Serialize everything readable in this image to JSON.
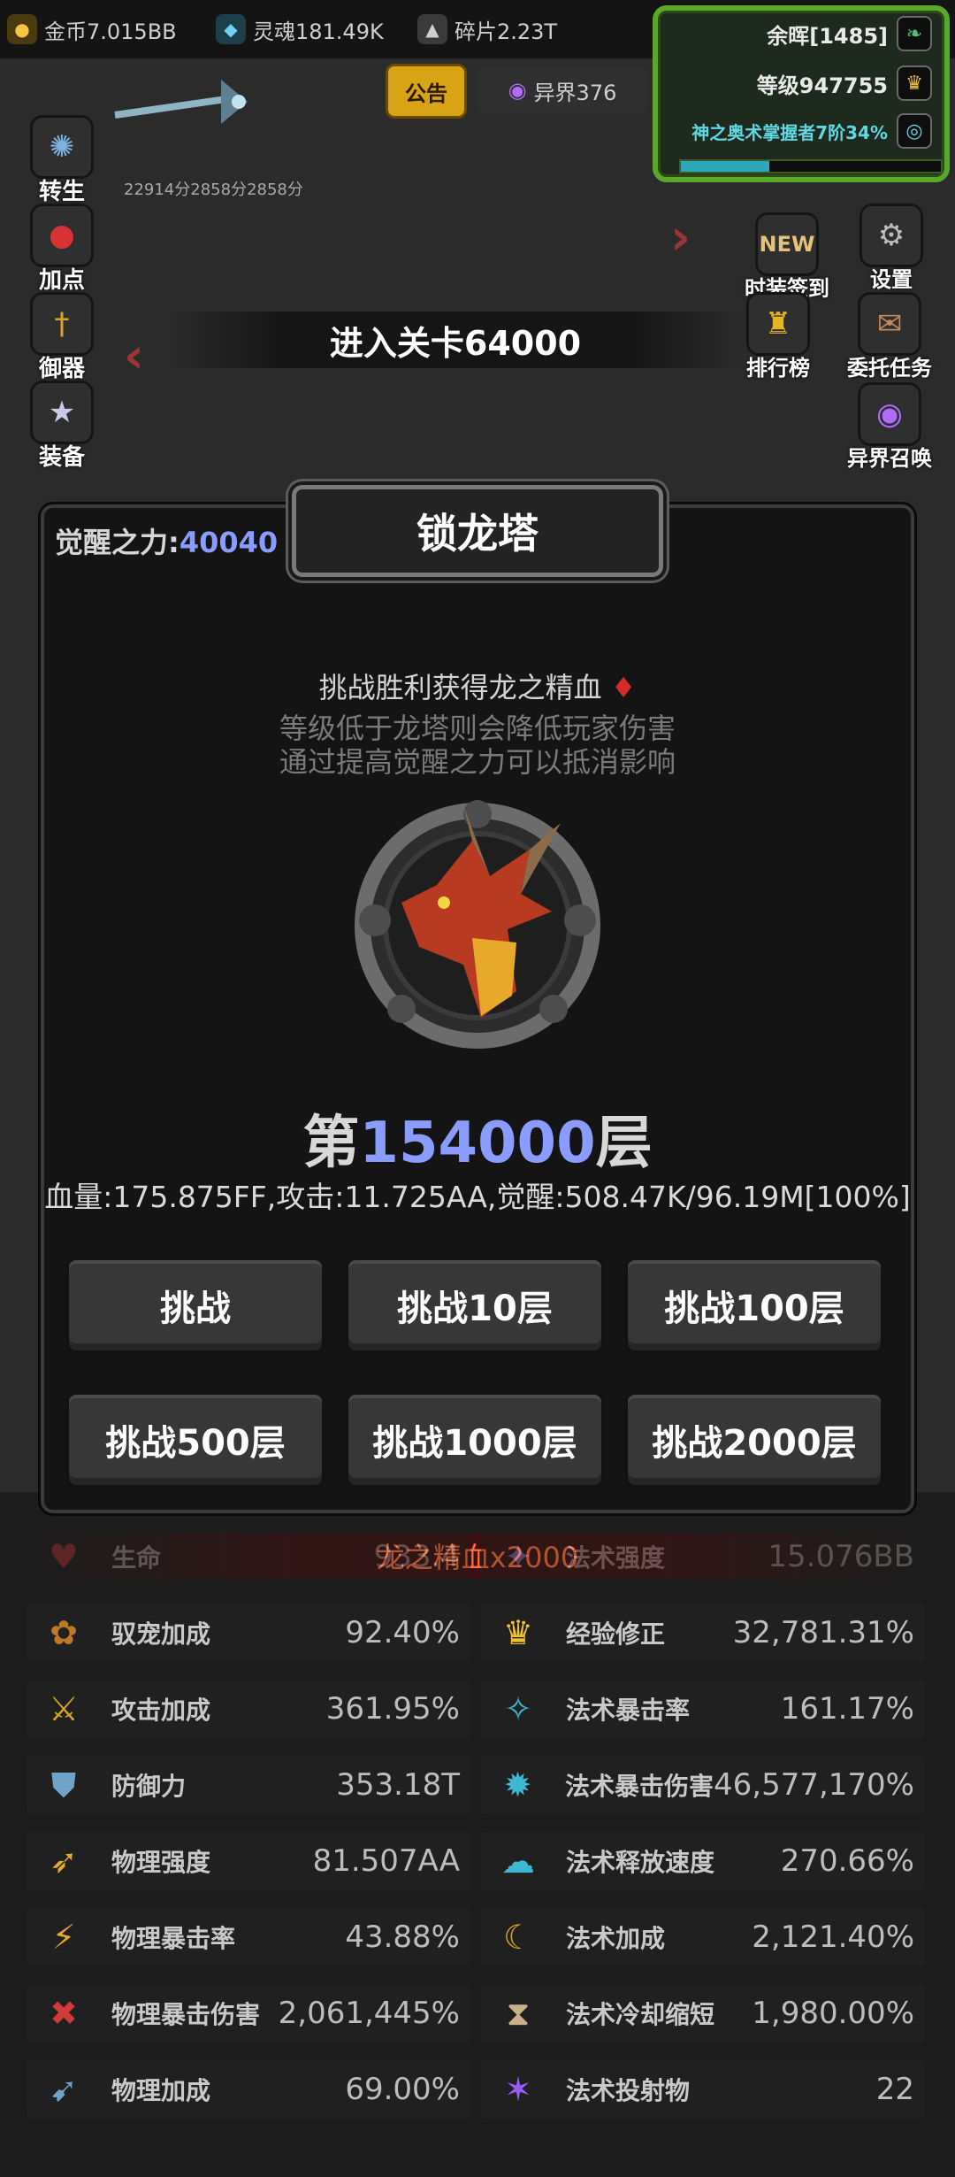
{
  "resources": {
    "gold": "金币7.015BB",
    "soul": "灵魂181.49K",
    "shards": "碎片2.23T"
  },
  "player": {
    "name": "余晖[1485]",
    "level": "等级947755",
    "title": "神之奥术掌握者7阶34%",
    "title_progress": 0.34
  },
  "top_buttons": {
    "notice": "公告",
    "otherworld": "异界376"
  },
  "score_text": "22914分2858分2858分",
  "left_menu": [
    "转生",
    "加点",
    "御器",
    "装备"
  ],
  "right_menu": {
    "fashion_signin": "时装签到",
    "new_badge": "NEW",
    "settings": "设置",
    "ranking": "排行榜",
    "commission": "委托任务",
    "summon": "异界召唤"
  },
  "stage_banner": "进入关卡64000",
  "modal": {
    "title": "锁龙塔",
    "awaken_label": "觉醒之力:",
    "awaken_value": "40040",
    "desc1": "挑战胜利获得龙之精血",
    "desc2": "等级低于龙塔则会降低玩家伤害",
    "desc3": "通过提高觉醒之力可以抵消影响",
    "floor_prefix": "第",
    "floor_number": "154000",
    "floor_suffix": "层",
    "boss_stats": "血量:175.875FF,攻击:11.725AA,觉醒:508.47K/96.19M[100%]",
    "buttons": [
      "挑战",
      "挑战10层",
      "挑战100层",
      "挑战500层",
      "挑战1000层",
      "挑战2000层"
    ]
  },
  "reward_text": "龙之精血x2000",
  "stats_left": [
    {
      "name": "生命",
      "value": "933.4",
      "icon": "heart-icon"
    },
    {
      "name": "驭宠加成",
      "value": "92.40%",
      "icon": "paw-icon"
    },
    {
      "name": "攻击加成",
      "value": "361.95%",
      "icon": "swords-icon"
    },
    {
      "name": "防御力",
      "value": "353.18T",
      "icon": "shield-icon"
    },
    {
      "name": "物理强度",
      "value": "81.507AA",
      "icon": "blade-icon"
    },
    {
      "name": "物理暴击率",
      "value": "43.88%",
      "icon": "crit-icon"
    },
    {
      "name": "物理暴击伤害",
      "value": "2,061,445%",
      "icon": "crit-damage-icon"
    },
    {
      "name": "物理加成",
      "value": "69.00%",
      "icon": "physical-icon"
    }
  ],
  "stats_right": [
    {
      "name": "法术强度",
      "value": "15.076BB",
      "icon": "magic-icon"
    },
    {
      "name": "经验修正",
      "value": "32,781.31%",
      "icon": "crown-icon"
    },
    {
      "name": "法术暴击率",
      "value": "161.17%",
      "icon": "spell-crit-icon"
    },
    {
      "name": "法术暴击伤害",
      "value": "46,577,170%",
      "icon": "spell-crit-damage-icon"
    },
    {
      "name": "法术释放速度",
      "value": "270.66%",
      "icon": "cast-speed-icon"
    },
    {
      "name": "法术加成",
      "value": "2,121.40%",
      "icon": "spell-bonus-icon"
    },
    {
      "name": "法术冷却缩短",
      "value": "1,980.00%",
      "icon": "hourglass-icon"
    },
    {
      "name": "法术投射物",
      "value": "22",
      "icon": "projectile-icon"
    }
  ],
  "colors": {
    "accent_blue": "#8a9cff",
    "reward_orange": "#ff6f3b",
    "frame_green": "#5aa82a",
    "progress_teal": "#2aa7b8"
  }
}
